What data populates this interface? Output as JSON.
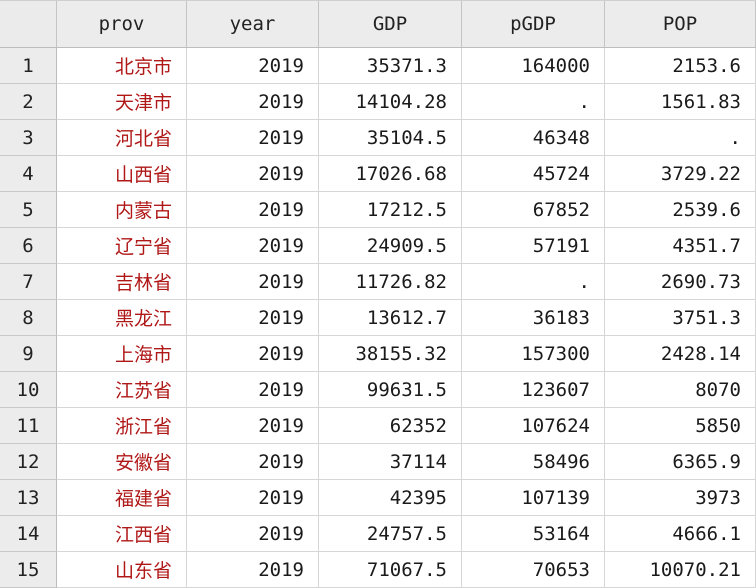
{
  "columns": [
    "prov",
    "year",
    "GDP",
    "pGDP",
    "POP"
  ],
  "rows": [
    {
      "n": "1",
      "prov": "北京市",
      "year": "2019",
      "GDP": "35371.3",
      "pGDP": "164000",
      "POP": "2153.6"
    },
    {
      "n": "2",
      "prov": "天津市",
      "year": "2019",
      "GDP": "14104.28",
      "pGDP": ".",
      "POP": "1561.83"
    },
    {
      "n": "3",
      "prov": "河北省",
      "year": "2019",
      "GDP": "35104.5",
      "pGDP": "46348",
      "POP": "."
    },
    {
      "n": "4",
      "prov": "山西省",
      "year": "2019",
      "GDP": "17026.68",
      "pGDP": "45724",
      "POP": "3729.22"
    },
    {
      "n": "5",
      "prov": "内蒙古",
      "year": "2019",
      "GDP": "17212.5",
      "pGDP": "67852",
      "POP": "2539.6"
    },
    {
      "n": "6",
      "prov": "辽宁省",
      "year": "2019",
      "GDP": "24909.5",
      "pGDP": "57191",
      "POP": "4351.7"
    },
    {
      "n": "7",
      "prov": "吉林省",
      "year": "2019",
      "GDP": "11726.82",
      "pGDP": ".",
      "POP": "2690.73"
    },
    {
      "n": "8",
      "prov": "黑龙江",
      "year": "2019",
      "GDP": "13612.7",
      "pGDP": "36183",
      "POP": "3751.3"
    },
    {
      "n": "9",
      "prov": "上海市",
      "year": "2019",
      "GDP": "38155.32",
      "pGDP": "157300",
      "POP": "2428.14"
    },
    {
      "n": "10",
      "prov": "江苏省",
      "year": "2019",
      "GDP": "99631.5",
      "pGDP": "123607",
      "POP": "8070"
    },
    {
      "n": "11",
      "prov": "浙江省",
      "year": "2019",
      "GDP": "62352",
      "pGDP": "107624",
      "POP": "5850"
    },
    {
      "n": "12",
      "prov": "安徽省",
      "year": "2019",
      "GDP": "37114",
      "pGDP": "58496",
      "POP": "6365.9"
    },
    {
      "n": "13",
      "prov": "福建省",
      "year": "2019",
      "GDP": "42395",
      "pGDP": "107139",
      "POP": "3973"
    },
    {
      "n": "14",
      "prov": "江西省",
      "year": "2019",
      "GDP": "24757.5",
      "pGDP": "53164",
      "POP": "4666.1"
    },
    {
      "n": "15",
      "prov": "山东省",
      "year": "2019",
      "GDP": "71067.5",
      "pGDP": "70653",
      "POP": "10070.21"
    }
  ],
  "colors": {
    "header_bg": "#ececec",
    "string_text": "#b01818",
    "numeric_text": "#1a1a1a",
    "grid_line": "#d6d6d6"
  }
}
